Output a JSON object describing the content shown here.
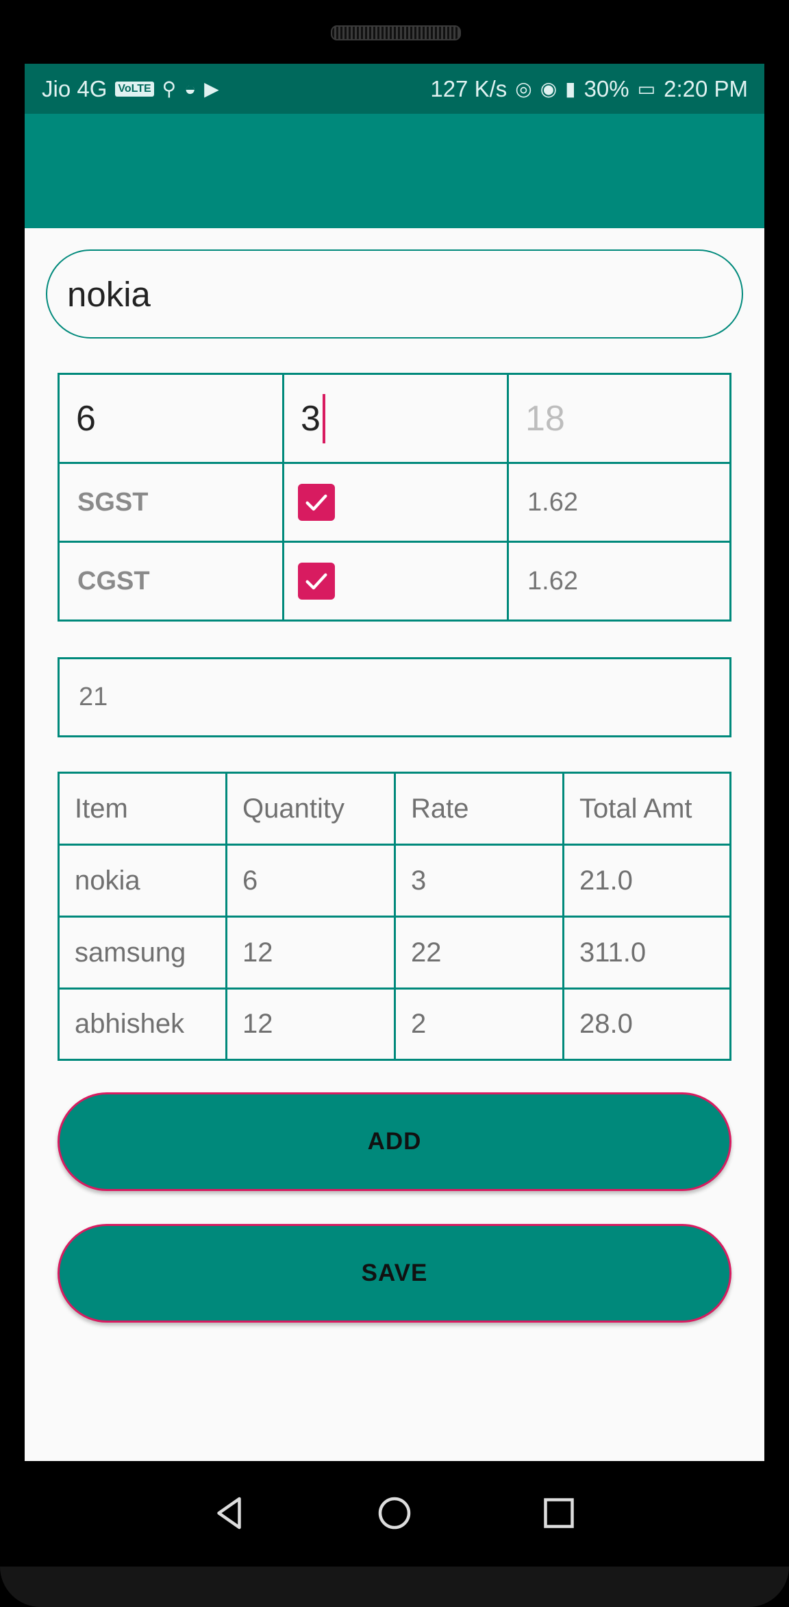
{
  "status_bar": {
    "carrier": "Jio 4G",
    "volte": "VoLTE",
    "speed": "127 K/s",
    "battery": "30%",
    "time": "2:20 PM"
  },
  "name_input": {
    "value": "nokia"
  },
  "calc": {
    "quantity_value": "6",
    "rate_value": "3",
    "gst_placeholder": "18",
    "sgst_label": "SGST",
    "sgst_checked": true,
    "sgst_value": "1.62",
    "cgst_label": "CGST",
    "cgst_checked": true,
    "cgst_value": "1.62"
  },
  "total_field": {
    "value": "21"
  },
  "items_table": {
    "headers": [
      "Item",
      "Quantity",
      "Rate",
      "Total Amt"
    ],
    "rows": [
      [
        "nokia",
        "6",
        "3",
        "21.0"
      ],
      [
        "samsung",
        "12",
        "22",
        "311.0"
      ],
      [
        "abhishek",
        "12",
        "2",
        "28.0"
      ]
    ]
  },
  "buttons": {
    "add_label": "ADD",
    "save_label": "SAVE"
  },
  "colors": {
    "primary": "#00897b",
    "primary_dark": "#00695c",
    "accent": "#d81b60"
  },
  "icons": [
    "back-icon",
    "home-icon",
    "recents-icon",
    "checkmark-icon"
  ]
}
